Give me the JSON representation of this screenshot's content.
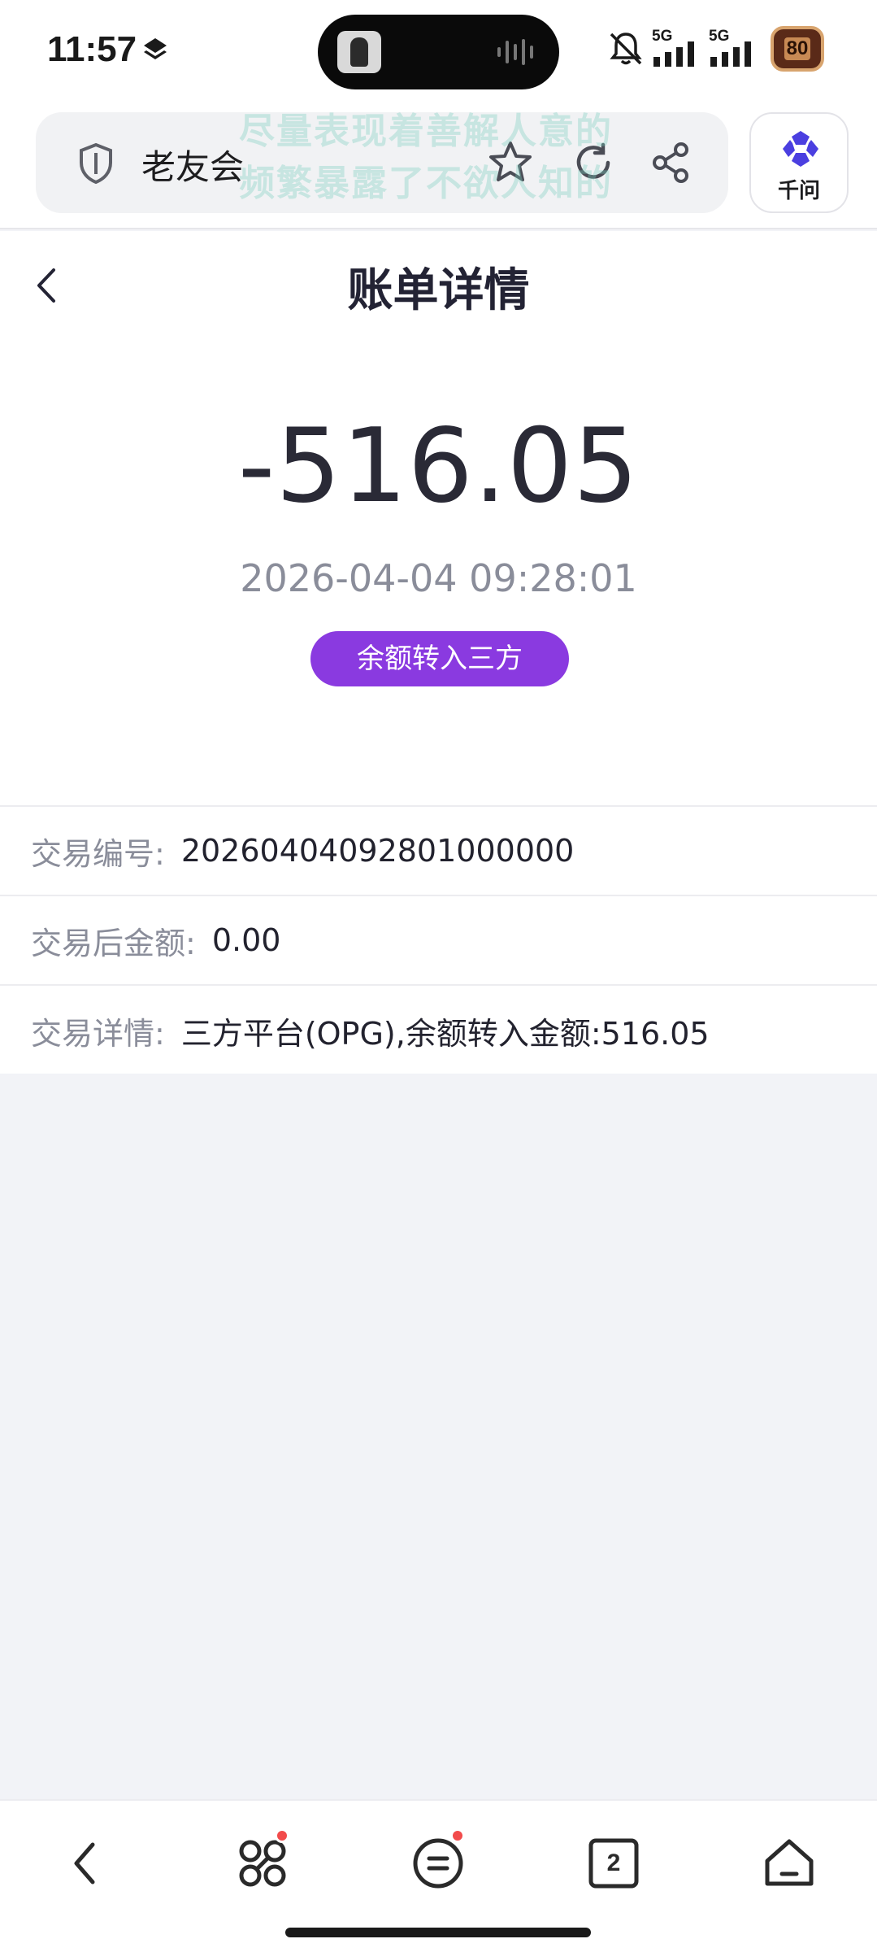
{
  "status_bar": {
    "time": "11:57",
    "signal_1_label": "5G",
    "signal_2_label": "5G",
    "battery": "80"
  },
  "browser": {
    "site_name": "老友会",
    "watermark_line_1": "尽量表现着善解人意的",
    "watermark_line_2": "频繁暴露了不欲人知的",
    "ai_label": "千问",
    "accent_color": "#4b3fe0"
  },
  "page": {
    "title": "账单详情",
    "amount": "-516.05",
    "datetime": "2026-04-04 09:28:01",
    "type_badge": "余额转入三方",
    "badge_color": "#8a3ae0"
  },
  "details": [
    {
      "label": "交易编号:",
      "value": "20260404092801000000"
    },
    {
      "label": "交易后金额:",
      "value": "0.00"
    },
    {
      "label": "交易详情:",
      "value": "三方平台(OPG),余额转入金额:516.05"
    }
  ],
  "bottom_nav": {
    "tab_count": "2",
    "icons": [
      "back-icon",
      "apps-icon",
      "menu-icon",
      "tabs-icon",
      "home-icon"
    ]
  }
}
